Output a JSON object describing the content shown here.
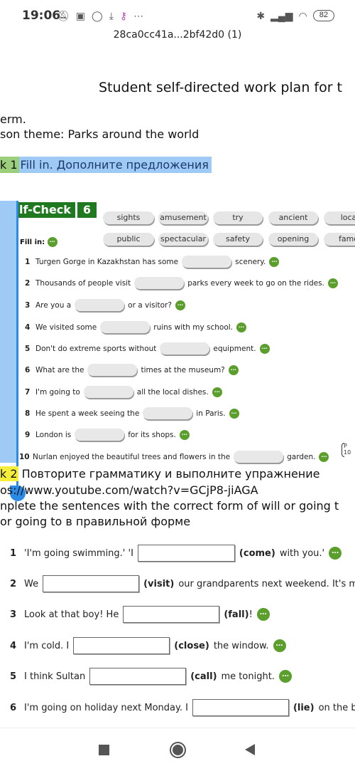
{
  "status_bar": {
    "time": "19:06",
    "left_icons": [
      "notifications-off-icon",
      "game-icon",
      "whatsapp-icon",
      "download-icon",
      "key-icon",
      "more-icon"
    ],
    "battery": "82"
  },
  "file_title": "28ca0cc41a...2bf42d0 (1)",
  "document": {
    "title": "Student self-directed work plan for t",
    "term": "erm.",
    "lesson_theme": "son theme:  Parks around the world",
    "task1": {
      "label": "k 1",
      "text": "Fill in. Дополните предложения"
    },
    "self_check": {
      "title": "lf-Check",
      "number": "6",
      "fill_in_label": "Fill in:",
      "word_bank": [
        "sights",
        "amusement",
        "try",
        "ancient",
        "loca",
        "public",
        "spectacular",
        "safety",
        "opening",
        "famo"
      ],
      "sentences": [
        {
          "num": "1",
          "before": "Turgen Gorge in Kazakhstan has some",
          "after": "scenery."
        },
        {
          "num": "2",
          "before": "Thousands of people visit",
          "after": "parks every week to go on the rides."
        },
        {
          "num": "3",
          "before": "Are you a",
          "after": "or a visitor?"
        },
        {
          "num": "4",
          "before": "We visited some",
          "after": "ruins with my school."
        },
        {
          "num": "5",
          "before": "Don't do extreme sports without",
          "after": "equipment."
        },
        {
          "num": "6",
          "before": "What are the",
          "after": "times at the museum?"
        },
        {
          "num": "7",
          "before": "I'm going to",
          "after": "all the local dishes."
        },
        {
          "num": "8",
          "before": "He spent a week seeing the",
          "after": "in Paris."
        },
        {
          "num": "9",
          "before": "London is",
          "after": "for its shops."
        },
        {
          "num": "10",
          "before": "Nurlan enjoyed the beautiful trees and flowers in the",
          "after": "garden."
        }
      ],
      "page_ref": [
        "P",
        "10"
      ]
    },
    "task2": {
      "label": "k 2",
      "text": "Повторите грамматику и выполните упражнение",
      "url": "os://www.youtube.com/watch?v=GCjP8-jiAGA",
      "instruction": "nplete the sentences with the correct form of will or going t",
      "instruction_ru": " or going to в правильной форме"
    },
    "grammar": [
      {
        "num": "1",
        "before": "'I'm going swimming.' 'I",
        "verb": "(come)",
        "after": "with you.'"
      },
      {
        "num": "2",
        "before": "We",
        "verb": "(visit)",
        "after": "our grandparents next weekend. It's mon"
      },
      {
        "num": "3",
        "before": "Look at that boy! He",
        "verb": "(fall)",
        "after": "!"
      },
      {
        "num": "4",
        "before": "I'm cold. I",
        "verb": "(close)",
        "after": "the window."
      },
      {
        "num": "5",
        "before": "I think Sultan",
        "verb": "(call)",
        "after": "me tonight."
      },
      {
        "num": "6",
        "before": "I'm going on holiday next Monday. I",
        "verb": "(lie)",
        "after": "on the bea"
      }
    ],
    "hint_icon": "more-dots-icon"
  },
  "nav": [
    "recents-button",
    "home-button",
    "back-button"
  ]
}
